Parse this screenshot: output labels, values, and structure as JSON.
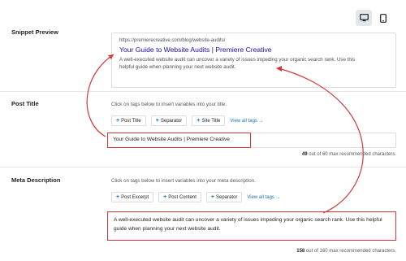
{
  "device_toggle": {
    "desktop_icon": "desktop-icon",
    "mobile_icon": "mobile-icon"
  },
  "snippet_preview": {
    "label": "Snippet Preview",
    "url": "https://premierecreative.com/blog/website-audits/",
    "title": "Your Guide to Website Audits | Premiere Creative",
    "description": "A well-executed website audit can uncover a variety of issues impeding your organic search rank. Use this helpful guide when planning your next website audit."
  },
  "post_title": {
    "label": "Post Title",
    "hint": "Click on tags below to insert variables into your title.",
    "tags": [
      {
        "label": "Post Title"
      },
      {
        "label": "Separator"
      },
      {
        "label": "Site Title"
      }
    ],
    "view_all": "View all tags →",
    "value": "Your Guide to Website Audits  | Premiere Creative",
    "count_current": "49",
    "count_text": "out of 60 max recommended characters."
  },
  "meta_description": {
    "label": "Meta Description",
    "hint": "Click on tags below to insert variables into your meta description.",
    "tags": [
      {
        "label": "Post Excerpt"
      },
      {
        "label": "Post Content"
      },
      {
        "label": "Separator"
      }
    ],
    "view_all": "View all tags →",
    "value": "A well-executed website audit can uncover a variety of issues impeding your organic search rank. Use this helpful guide when planning your next website audit.",
    "count_current": "158",
    "count_text": "out of 160 max recommended characters."
  },
  "colors": {
    "link": "#1a0dab",
    "accent": "#2271b1",
    "highlight": "#d63638"
  }
}
